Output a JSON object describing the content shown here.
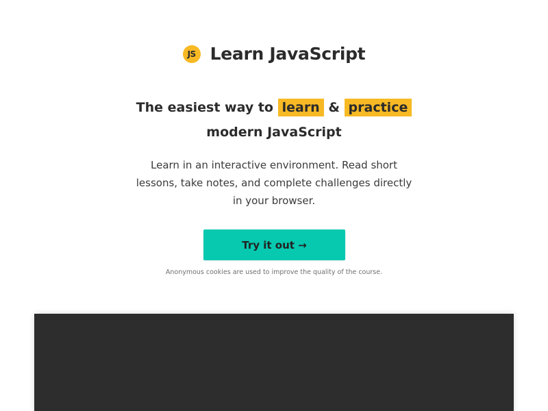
{
  "brand": {
    "logo_text": "JS",
    "title": "Learn JavaScript"
  },
  "hero": {
    "headline_prefix": "The easiest way to",
    "highlight_1": "learn",
    "connector": "&",
    "highlight_2": "practice",
    "headline_suffix": "modern JavaScript",
    "description": "Learn in an interactive environment. Read short lessons, take notes, and complete challenges directly in your browser.",
    "cta_label": "Try it out →",
    "cookie_note": "Anonymous cookies are used to improve the quality of the course."
  },
  "colors": {
    "accent_yellow": "#f7b924",
    "cta_teal": "#06c9b0",
    "preview_dark": "#2d2d2d"
  }
}
